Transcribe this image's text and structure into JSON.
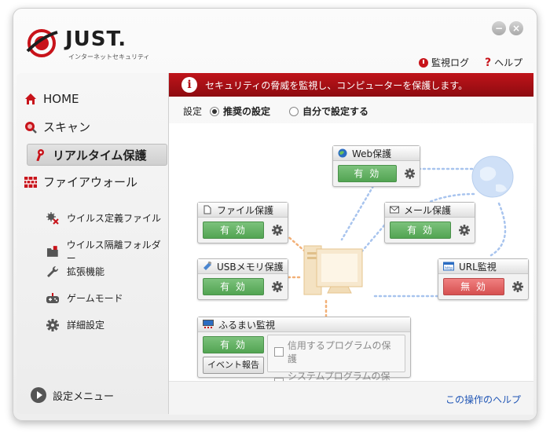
{
  "header": {
    "logo_text": "JUST.",
    "logo_subtitle": "インターネットセキュリティ",
    "log_label": "監視ログ",
    "help_label": "ヘルプ"
  },
  "sidebar": {
    "main_items": [
      {
        "label": "HOME",
        "icon": "home-icon"
      },
      {
        "label": "スキャン",
        "icon": "scan-icon"
      },
      {
        "label": "リアルタイム保護",
        "icon": "key-icon",
        "active": true
      },
      {
        "label": "ファイアウォール",
        "icon": "firewall-icon"
      }
    ],
    "sub_items": [
      {
        "label": "ウイルス定義ファイル",
        "icon": "virus-definition-icon"
      },
      {
        "label": "ウイルス隔離フォルダー",
        "icon": "quarantine-folder-icon"
      },
      {
        "label": "拡張機能",
        "icon": "wrench-icon"
      },
      {
        "label": "ゲームモード",
        "icon": "gamepad-icon"
      },
      {
        "label": "詳細設定",
        "icon": "gear-icon"
      }
    ],
    "bottom_label": "設定メニュー"
  },
  "main": {
    "banner_text": "セキュリティの脅威を監視し、コンピューターを保護します。",
    "settings_label": "設定",
    "radio_recommended": "推奨の設定",
    "radio_custom": "自分で設定する",
    "selected_option": "推奨の設定",
    "footer_help": "この操作のヘルプ"
  },
  "cards": {
    "web": {
      "title": "Web保護",
      "status": "有 効"
    },
    "file": {
      "title": "ファイル保護",
      "status": "有 効"
    },
    "mail": {
      "title": "メール保護",
      "status": "有 効"
    },
    "usb": {
      "title": "USBメモリ保護",
      "status": "有 効"
    },
    "url": {
      "title": "URL監視",
      "status": "無 効"
    },
    "behavior": {
      "title": "ふるまい監視",
      "status": "有 効",
      "event_button": "イベント報告",
      "checkbox1": "信用するプログラムの保護",
      "checkbox2": "システムプログラムの保護"
    }
  },
  "colors": {
    "brand_red": "#c8131a",
    "enabled_green": "#5fae5f",
    "disabled_red": "#e06464",
    "link_blue": "#1f55b5"
  }
}
